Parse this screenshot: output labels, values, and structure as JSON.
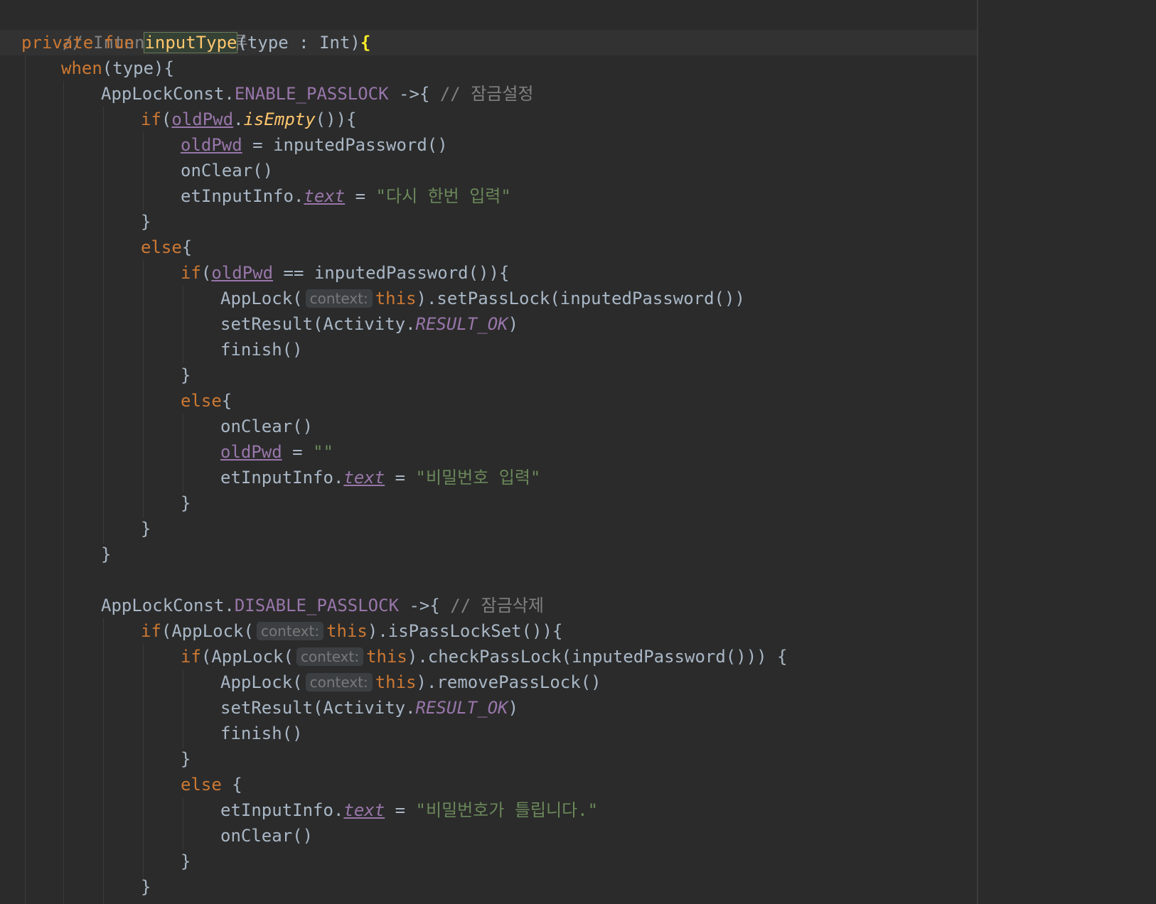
{
  "editor": {
    "language": "Kotlin",
    "theme": "Darcula",
    "colors": {
      "background": "#2b2b2b",
      "keyword": "#cc7832",
      "comment": "#808080",
      "string": "#6a8759",
      "function": "#ffc66d",
      "property": "#9876aa",
      "text": "#a9b7c6"
    }
  },
  "code": {
    "comment_intent": "// Intent Type 분류",
    "kw_private": "private",
    "kw_fun": "fun",
    "fn_name": "inputType",
    "params": "(type : Int)",
    "brace_open": "{",
    "kw_when": "when",
    "when_arg": "(type){",
    "app_lock_const": "AppLockConst.",
    "enable_const": "ENABLE_PASSLOCK",
    "disable_const": "DISABLE_PASSLOCK",
    "arrow": " ->{ ",
    "comment_lock_set": "// 잠금설정",
    "comment_lock_delete": "// 잠금삭제",
    "kw_if": "if",
    "kw_else": "else",
    "kw_this": "this",
    "paren_open": "(",
    "old_pwd": "oldPwd",
    "dot": ".",
    "is_empty": "isEmpty",
    "is_empty_tail": "()){",
    "assign": " = ",
    "inputed_password_call": "inputedPassword()",
    "on_clear": "onClear()",
    "et_input_info": "etInputInfo.",
    "text_prop": "text",
    "str_again": "\"다시 한번 입력\"",
    "str_enter_pw": "\"비밀번호 입력\"",
    "str_wrong_pw": "\"비밀번호가 틀립니다.\"",
    "str_empty": "\"\"",
    "close_brace": "}",
    "else_brace": "{",
    "else_space_brace": " {",
    "equals_compare": " == ",
    "inputed_password_tail": "inputedPassword()){",
    "app_lock_open": "AppLock(",
    "context_hint": "context:",
    "set_pass_lock": ").setPassLock(inputedPassword())",
    "set_result": "setResult(Activity.",
    "result_ok": "RESULT_OK",
    "close_paren": ")",
    "finish": "finish()",
    "is_pass_lock_set": ").isPassLockSet()){",
    "check_pass_lock": ").checkPassLock(inputedPassword())) {",
    "remove_pass_lock": ").removePassLock()"
  }
}
